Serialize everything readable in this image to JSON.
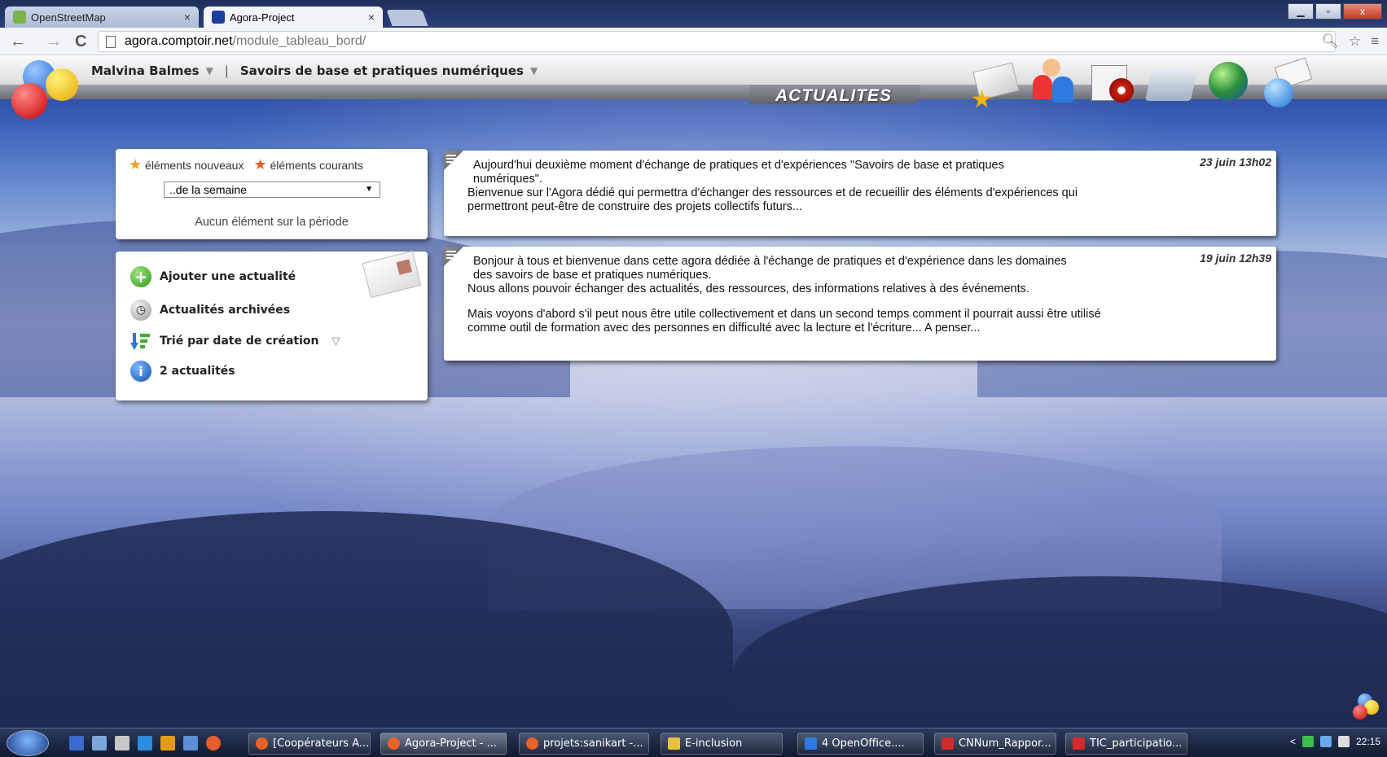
{
  "browser": {
    "tabs": [
      {
        "label": "OpenStreetMap",
        "active": false
      },
      {
        "label": "Agora-Project",
        "active": true
      }
    ],
    "close_glyph": "×",
    "url_domain": "agora.comptoir.net",
    "url_path": "/module_tableau_bord/",
    "nav": {
      "back": "←",
      "forward": "→",
      "reload": "C"
    },
    "window_buttons": {
      "minimize": "▁",
      "maximize": "▫",
      "close": "x"
    }
  },
  "header": {
    "user_name": "Malvina Balmes",
    "space_name": "Savoirs de base et pratiques numériques",
    "module_title": "ACTUALITES",
    "separator": "|",
    "chevron": "▼",
    "module_icons": [
      "news-icon",
      "users-icon",
      "calendar-icon",
      "folder-icon",
      "globe-icon",
      "mail-icon"
    ]
  },
  "filter_panel": {
    "legend_new": "éléments nouveaux",
    "legend_current": "éléments courants",
    "period_select": "..de la semaine",
    "empty_text": "Aucun élément sur la période"
  },
  "actions_panel": {
    "add_news": "Ajouter une actualité",
    "archived_news": "Actualités archivées",
    "sort_label": "Trié par date de création",
    "count_label": "2 actualités"
  },
  "news": [
    {
      "date": "23 juin 13h02",
      "lines": [
        "Aujourd'hui deuxième moment d'échange de pratiques et d'expériences \"Savoirs de base et pratiques",
        "numériques\".",
        "Bienvenue sur l'Agora dédié qui permettra d'échanger des ressources et de recueillir des éléments d'expériences qui",
        "permettront peut-être de construire des projets collectifs futurs..."
      ]
    },
    {
      "date": "19 juin 12h39",
      "lines": [
        "Bonjour à tous et bienvenue dans cette agora dédiée à l'échange de pratiques et d'expérience dans les domaines",
        "des savoirs de base et pratiques numériques.",
        "Nous allons pouvoir échanger des actualités, des ressources, des informations relatives à des événements.",
        "Mais voyons d'abord s'il peut nous être utile collectivement et dans un second temps comment il pourrait aussi être utilisé",
        "comme outil de formation avec des personnes en difficulté avec la lecture et l'écriture... A penser..."
      ]
    }
  ],
  "taskbar": {
    "items": [
      "[Coopérateurs A...",
      "Agora-Project - ...",
      "projets:sanikart -...",
      "E-inclusion",
      "4 OpenOffice....",
      "CNNum_Rappor...",
      "TIC_participatio..."
    ],
    "clock": "22:15"
  },
  "colors": {
    "sky_top": "#1d3a8a",
    "mist": "#c9cde6",
    "header_band": "#6b6e74"
  }
}
